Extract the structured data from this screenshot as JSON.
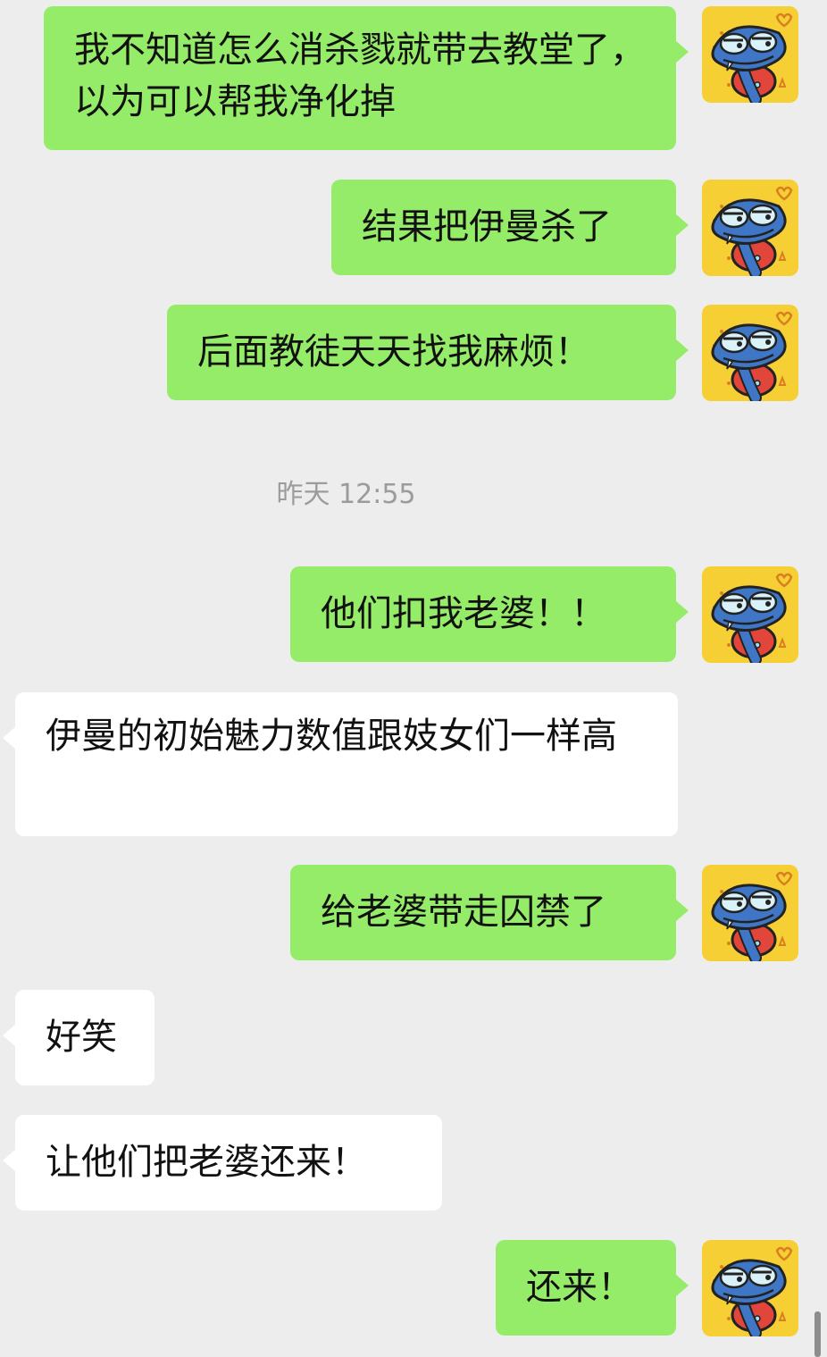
{
  "messages": [
    {
      "side": "out",
      "text": "我不知道怎么消杀戮就带去教堂了，以为可以帮我净化掉"
    },
    {
      "side": "out",
      "text": "结果把伊曼杀了"
    },
    {
      "side": "out",
      "text": "后面教徒天天找我麻烦！"
    },
    {
      "side": "out",
      "text": "他们扣我老婆！！"
    },
    {
      "side": "in",
      "text": "伊曼的初始魅力数值跟妓女们一样高"
    },
    {
      "side": "out",
      "text": "给老婆带走囚禁了"
    },
    {
      "side": "in",
      "text": "好笑"
    },
    {
      "side": "in",
      "text": "让他们把老婆还来！"
    },
    {
      "side": "out",
      "text": "还来！"
    }
  ],
  "timestamp": "昨天 12:55",
  "colors": {
    "background": "#ededed",
    "outgoing_bubble": "#95ec69",
    "incoming_bubble": "#ffffff",
    "timestamp_text": "#9b9b9b"
  }
}
